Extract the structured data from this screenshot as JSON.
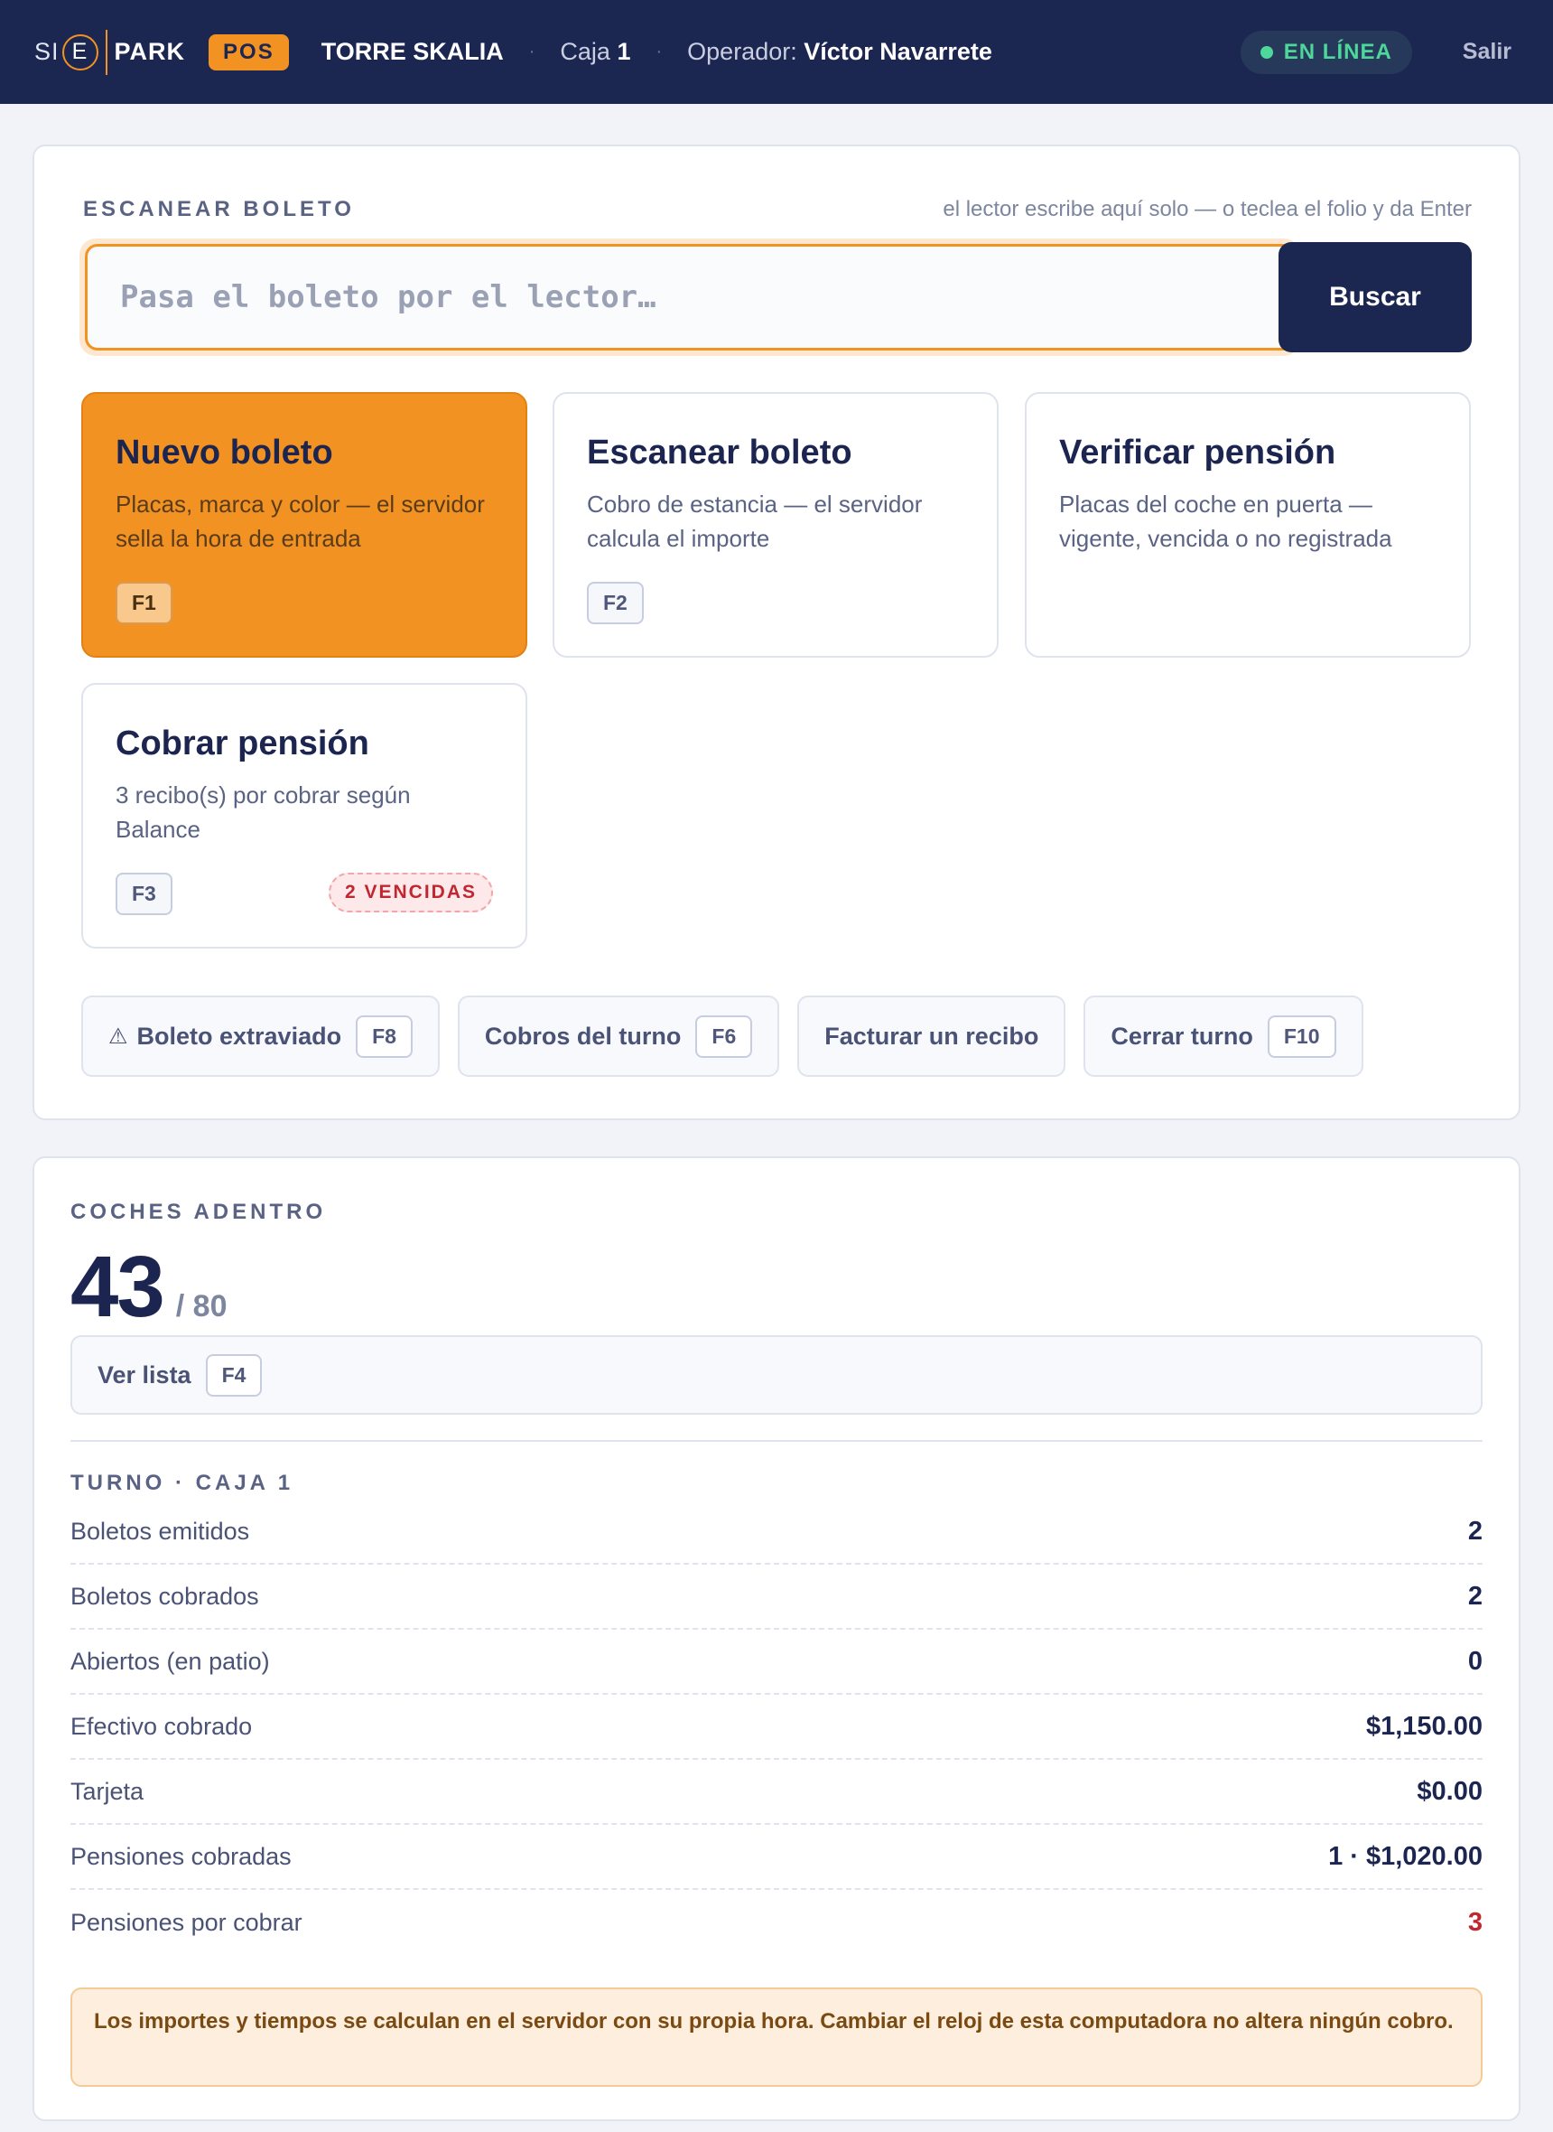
{
  "header": {
    "logo_si": "SI",
    "logo_e": "E",
    "logo_park": "PARK",
    "pos_badge": "POS",
    "site": "TORRE SKALIA",
    "separator": "·",
    "caja_label": "Caja",
    "caja_number": "1",
    "operator_label": "Operador:",
    "operator_name": "Víctor Navarrete",
    "status": "EN LÍNEA",
    "status_color": "#4ed79b",
    "logout": "Salir"
  },
  "scan": {
    "title": "ESCANEAR BOLETO",
    "hint": "el lector escribe aquí solo — o teclea el folio y da Enter",
    "placeholder": "Pasa el boleto por el lector…",
    "value": "",
    "search_button": "Buscar"
  },
  "actions": [
    {
      "title": "Nuevo boleto",
      "description": "Placas, marca y color — el servidor sella la hora de entrada",
      "shortcut": "F1",
      "accent": "#f29222"
    },
    {
      "title": "Escanear boleto",
      "description": "Cobro de estancia — el servidor calcula el importe",
      "shortcut": "F2"
    },
    {
      "title": "Verificar pensión",
      "description": "Placas del coche en puerta — vigente, vencida o no registrada"
    },
    {
      "title": "Cobrar pensión",
      "description": "3 recibo(s) por cobrar según Balance",
      "shortcut": "F3",
      "badge": "2 VENCIDAS"
    }
  ],
  "quick_actions": [
    {
      "icon": "warning-icon",
      "label": "Boleto extraviado",
      "shortcut": "F8"
    },
    {
      "label": "Cobros del turno",
      "shortcut": "F6"
    },
    {
      "label": "Facturar un recibo"
    },
    {
      "label": "Cerrar turno",
      "shortcut": "F10"
    }
  ],
  "cars_inside": {
    "title": "COCHES ADENTRO",
    "count": "43",
    "capacity": "/ 80",
    "list_button": "Ver lista",
    "list_shortcut": "F4"
  },
  "shift": {
    "title": "TURNO · CAJA 1",
    "rows": [
      {
        "label": "Boletos emitidos",
        "value": "2"
      },
      {
        "label": "Boletos cobrados",
        "value": "2"
      },
      {
        "label": "Abiertos (en patio)",
        "value": "0"
      },
      {
        "label": "Efectivo cobrado",
        "value": "$1,150.00"
      },
      {
        "label": "Tarjeta",
        "value": "$0.00"
      },
      {
        "label": "Pensiones cobradas",
        "value": "1 · $1,020.00"
      },
      {
        "label": "Pensiones por cobrar",
        "value": "3",
        "alert_color": "#c02730"
      }
    ]
  },
  "notice": "Los importes y tiempos se calculan en el servidor con su propia hora. Cambiar el reloj de esta computadora no altera ningún cobro."
}
